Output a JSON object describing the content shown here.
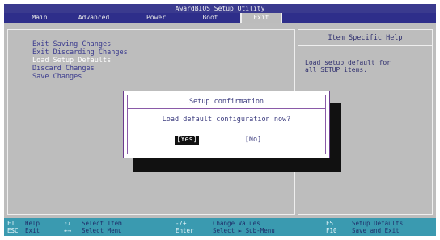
{
  "app": {
    "title": "AwardBIOS Setup Utility"
  },
  "menu": {
    "items": [
      {
        "label": "Main"
      },
      {
        "label": "Advanced"
      },
      {
        "label": "Power"
      },
      {
        "label": "Boot"
      },
      {
        "label": "Exit"
      }
    ],
    "active_index": 4
  },
  "options": [
    {
      "label": "Exit Saving Changes"
    },
    {
      "label": "Exit Discarding Changes"
    },
    {
      "label": "Load Setup Defaults"
    },
    {
      "label": "Discard Changes"
    },
    {
      "label": "Save Changes"
    }
  ],
  "help": {
    "title": "Item Specific Help",
    "text": "Load setup default for\nall SETUP items."
  },
  "dialog": {
    "title": "Setup confirmation",
    "message": "Load default configuration now?",
    "yes_label": "[Yes]",
    "no_label": "[No]"
  },
  "statusbar": {
    "items": [
      {
        "key": "F1",
        "desc": "Help"
      },
      {
        "key": "ESC",
        "desc": "Exit"
      },
      {
        "key": "↑↓",
        "desc": "Select Item"
      },
      {
        "key": "←→",
        "desc": "Select Menu"
      },
      {
        "key": "-/+",
        "desc": "Change Values"
      },
      {
        "key": "Enter",
        "desc": "Select ► Sub-Menu"
      },
      {
        "key": "F5",
        "desc": "Setup Defaults"
      },
      {
        "key": "F10",
        "desc": "Save and Exit"
      }
    ]
  },
  "colors": {
    "title_bar": "#3a3a8e",
    "background": "#bdbdbd",
    "text": "#3b3b8e",
    "status_bar": "#3a9ab0"
  }
}
